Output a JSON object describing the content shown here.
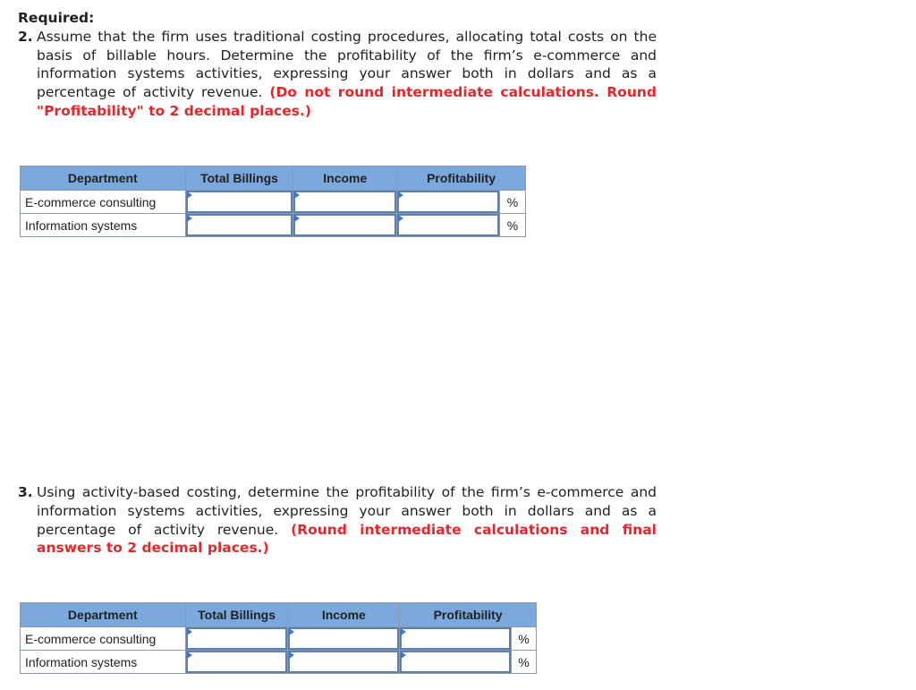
{
  "required_label": "Required:",
  "q2": {
    "number": "2.",
    "text": "Assume that the firm uses traditional costing procedures, allocating total costs on the basis of billable hours. Determine the profitability of the firm’s e-commerce and information systems activities, expressing your answer both in dollars and as a percentage of activity revenue.",
    "instruction": "(Do not round intermediate calculations. Round \"Profitability\" to 2 decimal places.)"
  },
  "q3": {
    "number": "3.",
    "text": "Using activity-based costing, determine the profitability of the firm’s e-commerce and information systems activities, expressing your answer both in dollars and as a percentage of activity revenue.",
    "instruction": "(Round intermediate calculations and final answers to 2 decimal places.)"
  },
  "table2": {
    "headers": [
      "Department",
      "Total Billings",
      "Income",
      "Profitability"
    ],
    "rows": [
      {
        "department": "E-commerce consulting",
        "total_billings": "",
        "income": "",
        "profitability": "",
        "unit": "%"
      },
      {
        "department": "Information systems",
        "total_billings": "",
        "income": "",
        "profitability": "",
        "unit": "%"
      }
    ]
  },
  "table3": {
    "headers": [
      "Department",
      "Total Billings",
      "Income",
      "Profitability"
    ],
    "rows": [
      {
        "department": "E-commerce consulting",
        "total_billings": "",
        "income": "",
        "profitability": "",
        "unit": "%"
      },
      {
        "department": "Information systems",
        "total_billings": "",
        "income": "",
        "profitability": "",
        "unit": "%"
      }
    ]
  }
}
